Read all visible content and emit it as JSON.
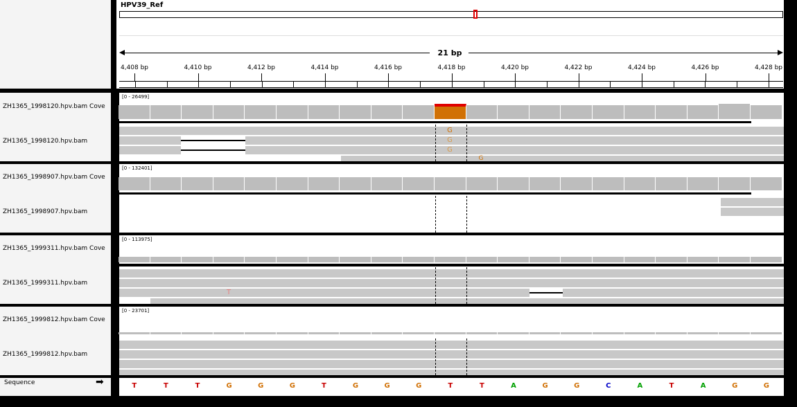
{
  "header": {
    "reference_name": "HPV39_Ref",
    "span_label": "21 bp"
  },
  "ruler_ticks": [
    "4,408 bp",
    "4,410 bp",
    "4,412 bp",
    "4,414 bp",
    "4,416 bp",
    "4,418 bp",
    "4,420 bp",
    "4,422 bp",
    "4,424 bp",
    "4,426 bp",
    "4,428 bp"
  ],
  "tracks": [
    {
      "coverage_name": "ZH1365_1998120.hpv.bam Cove",
      "reads_name": "ZH1365_1998120.hpv.bam",
      "range": "[0 - 26499]"
    },
    {
      "coverage_name": "ZH1365_1998907.hpv.bam Cove",
      "reads_name": "ZH1365_1998907.hpv.bam",
      "range": "[0 - 132401]"
    },
    {
      "coverage_name": "ZH1365_1999311.hpv.bam Cove",
      "reads_name": "ZH1365_1999311.hpv.bam",
      "range": "[0 - 113975]"
    },
    {
      "coverage_name": "ZH1365_1999812.hpv.bam Cove",
      "reads_name": "ZH1365_1999812.hpv.bam",
      "range": "[0 - 23701]"
    }
  ],
  "mismatches": {
    "track1": "G",
    "track3": "T"
  },
  "sequence": {
    "label": "Sequence",
    "bases": [
      "T",
      "T",
      "T",
      "G",
      "G",
      "G",
      "T",
      "G",
      "G",
      "G",
      "T",
      "T",
      "A",
      "G",
      "G",
      "C",
      "A",
      "T",
      "A",
      "G",
      "G"
    ]
  },
  "colors": {
    "A": "#00a000",
    "C": "#0000c8",
    "G": "#d17105",
    "T": "#c80000",
    "highlight": "#d17105"
  }
}
